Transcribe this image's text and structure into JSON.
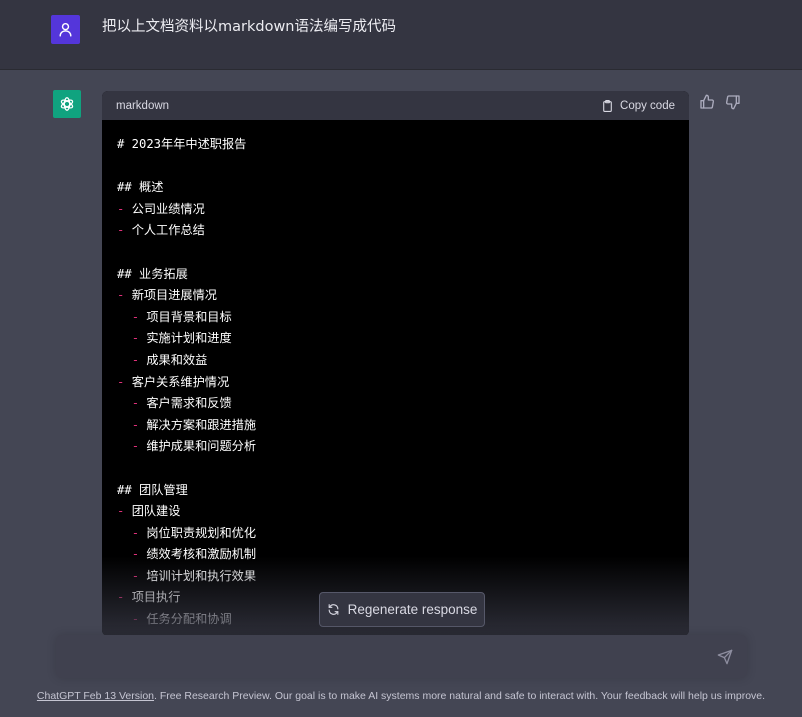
{
  "user_message": "把以上文档资料以markdown语法编写成代码",
  "code_block": {
    "language": "markdown",
    "copy_label": "Copy code",
    "lines": [
      {
        "indent": 0,
        "dash": "",
        "text": "# 2023年年中述职报告"
      },
      {
        "indent": 0,
        "dash": "",
        "text": ""
      },
      {
        "indent": 0,
        "dash": "",
        "text": "## 概述"
      },
      {
        "indent": 0,
        "dash": "-",
        "text": "公司业绩情况"
      },
      {
        "indent": 0,
        "dash": "-",
        "text": "个人工作总结"
      },
      {
        "indent": 0,
        "dash": "",
        "text": ""
      },
      {
        "indent": 0,
        "dash": "",
        "text": "## 业务拓展"
      },
      {
        "indent": 0,
        "dash": "-",
        "text": "新项目进展情况"
      },
      {
        "indent": 1,
        "dash": "-",
        "text": "项目背景和目标"
      },
      {
        "indent": 1,
        "dash": "-",
        "text": "实施计划和进度"
      },
      {
        "indent": 1,
        "dash": "-",
        "text": "成果和效益"
      },
      {
        "indent": 0,
        "dash": "-",
        "text": "客户关系维护情况"
      },
      {
        "indent": 1,
        "dash": "-",
        "text": "客户需求和反馈"
      },
      {
        "indent": 1,
        "dash": "-",
        "text": "解决方案和跟进措施"
      },
      {
        "indent": 1,
        "dash": "-",
        "text": "维护成果和问题分析"
      },
      {
        "indent": 0,
        "dash": "",
        "text": ""
      },
      {
        "indent": 0,
        "dash": "",
        "text": "## 团队管理"
      },
      {
        "indent": 0,
        "dash": "-",
        "text": "团队建设"
      },
      {
        "indent": 1,
        "dash": "-",
        "text": "岗位职责规划和优化"
      },
      {
        "indent": 1,
        "dash": "-",
        "text": "绩效考核和激励机制"
      },
      {
        "indent": 1,
        "dash": "-",
        "text": "培训计划和执行效果"
      },
      {
        "indent": 0,
        "dash": "-",
        "text": "项目执行"
      },
      {
        "indent": 1,
        "dash": "-",
        "text": "任务分配和协调"
      }
    ]
  },
  "regenerate_label": "Regenerate response",
  "input": {
    "placeholder": ""
  },
  "footer": {
    "link_text": "ChatGPT Feb 13 Version",
    "text": ". Free Research Preview. Our goal is to make AI systems more natural and safe to interact with. Your feedback will help us improve."
  },
  "colors": {
    "background": "#343541",
    "assistant_bg": "#444654",
    "user_avatar": "#5436da",
    "gpt_avatar": "#10a37f",
    "dash": "#df3079"
  },
  "icons": {
    "user_avatar": "user-icon",
    "gpt_avatar": "openai-logo-icon",
    "copy": "clipboard-icon",
    "thumbs_up": "thumbs-up-icon",
    "thumbs_down": "thumbs-down-icon",
    "regenerate": "refresh-icon",
    "send": "paper-plane-icon"
  }
}
